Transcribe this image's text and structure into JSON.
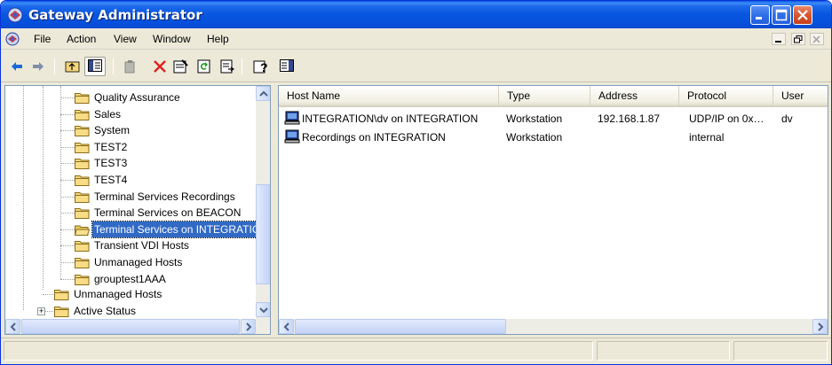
{
  "window": {
    "title": "Gateway Administrator"
  },
  "menu": {
    "items": [
      "File",
      "Action",
      "View",
      "Window",
      "Help"
    ]
  },
  "toolbar": {
    "tools": [
      "back-arrow-icon",
      "forward-arrow-icon",
      "up-folder-icon",
      "show-hide-tree-icon",
      "copy-icon",
      "delete-icon",
      "properties-icon",
      "refresh-icon",
      "export-list-icon",
      "help-icon",
      "action-pane-icon"
    ]
  },
  "tree": {
    "items": [
      {
        "label": "Quality Assurance",
        "selected": false
      },
      {
        "label": "Sales",
        "selected": false
      },
      {
        "label": "System",
        "selected": false
      },
      {
        "label": "TEST2",
        "selected": false
      },
      {
        "label": "TEST3",
        "selected": false
      },
      {
        "label": "TEST4",
        "selected": false
      },
      {
        "label": "Terminal Services Recordings",
        "selected": false
      },
      {
        "label": "Terminal Services on BEACON",
        "selected": false
      },
      {
        "label": "Terminal Services on INTEGRATIO",
        "selected": true
      },
      {
        "label": "Transient VDI Hosts",
        "selected": false
      },
      {
        "label": "Unmanaged Hosts",
        "selected": false
      },
      {
        "label": "grouptest1AAA",
        "selected": false
      }
    ],
    "parent_items": [
      {
        "label": "Unmanaged Hosts"
      },
      {
        "label": "Active Status",
        "expander": "+"
      }
    ]
  },
  "list": {
    "columns": [
      "Host Name",
      "Type",
      "Address",
      "Protocol",
      "User"
    ],
    "rows": [
      {
        "host_name": "INTEGRATION\\dv on INTEGRATION",
        "type": "Workstation",
        "address": "192.168.1.87",
        "protocol": "UDP/IP on 0x…",
        "user": "dv"
      },
      {
        "host_name": "Recordings on INTEGRATION",
        "type": "Workstation",
        "address": "",
        "protocol": "internal",
        "user": ""
      }
    ]
  },
  "colors": {
    "titlebar": "#0856e0",
    "selection": "#316ac5",
    "folder": "#f5d67a"
  }
}
